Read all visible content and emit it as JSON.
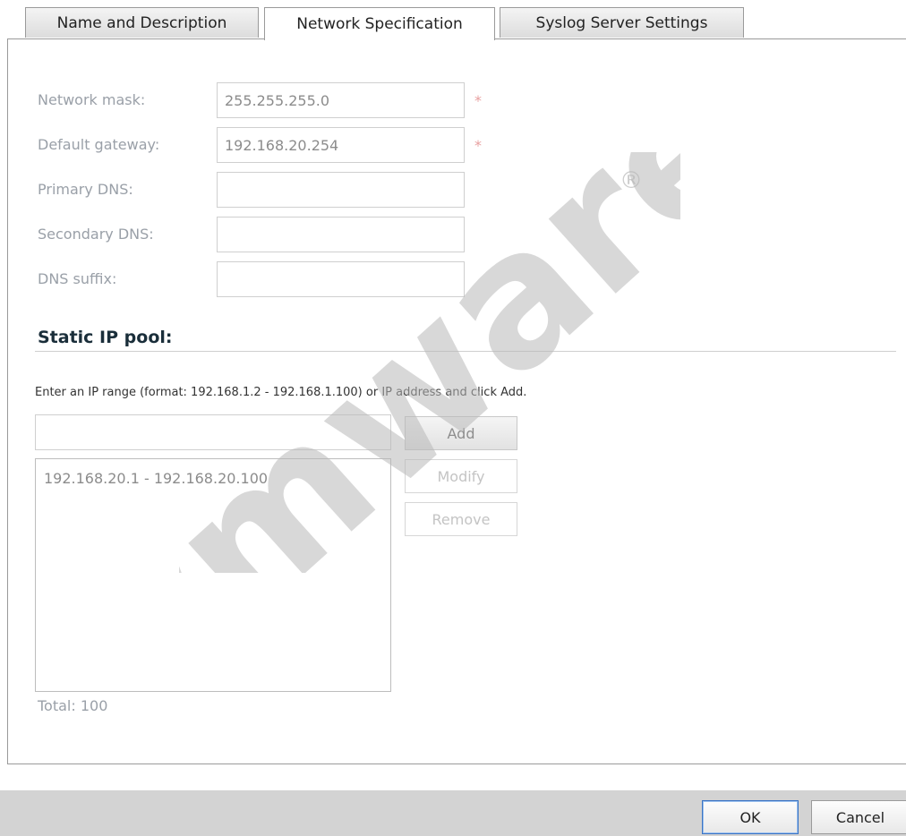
{
  "tabs": [
    {
      "label": "Name and Description",
      "active": false
    },
    {
      "label": "Network Specification",
      "active": true
    },
    {
      "label": "Syslog Server Settings",
      "active": false
    }
  ],
  "fields": {
    "network_mask": {
      "label": "Network mask:",
      "value": "255.255.255.0",
      "required": true
    },
    "default_gateway": {
      "label": "Default gateway:",
      "value": "192.168.20.254",
      "required": true
    },
    "primary_dns": {
      "label": "Primary DNS:",
      "value": ""
    },
    "secondary_dns": {
      "label": "Secondary DNS:",
      "value": ""
    },
    "dns_suffix": {
      "label": "DNS suffix:",
      "value": ""
    }
  },
  "required_marker": "*",
  "static_ip_pool": {
    "title": "Static IP pool:",
    "hint": "Enter an IP range (format: 192.168.1.2 - 192.168.1.100) or IP address and click Add.",
    "input_value": "",
    "entries": [
      "192.168.20.1 - 192.168.20.100"
    ],
    "buttons": {
      "add": "Add",
      "modify": "Modify",
      "remove": "Remove"
    },
    "total_label": "Total: 100"
  },
  "watermark": {
    "text": "vmware",
    "registered_mark": "®",
    "color": "#b8b8b8"
  },
  "footer": {
    "ok_label": "OK",
    "cancel_label": "Cancel"
  },
  "colors": {
    "accent_border": "#3b74c4",
    "required_star": "#e8a0a0",
    "footer_bg": "#d3d3d3"
  }
}
